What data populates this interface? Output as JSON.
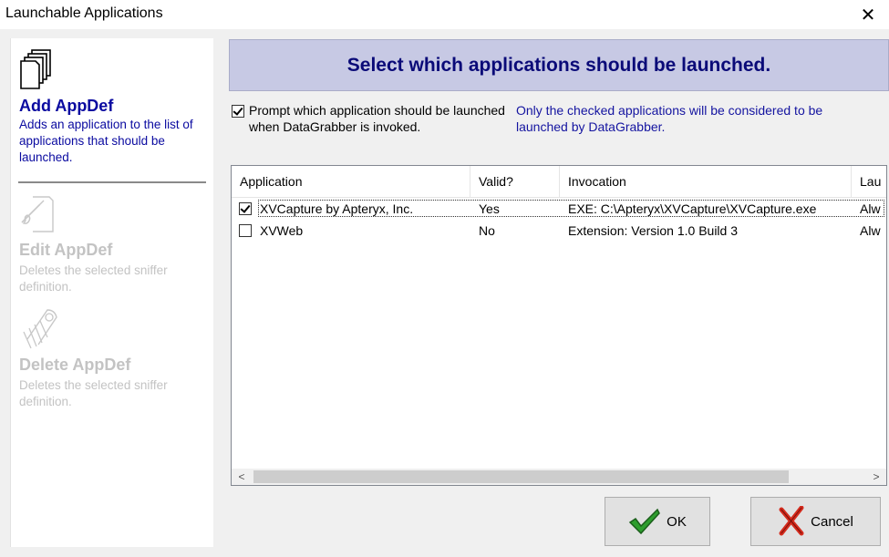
{
  "window": {
    "title": "Launchable Applications",
    "close_glyph": "✕"
  },
  "sidebar": {
    "add": {
      "title": "Add AppDef",
      "desc": "Adds an application to the list of applications that should be launched.",
      "icon": "document-stack-icon"
    },
    "edit": {
      "title": "Edit AppDef",
      "desc": "Deletes the selected sniffer definition.",
      "icon": "edit-document-icon"
    },
    "delete": {
      "title": "Delete AppDef",
      "desc": "Deletes the selected sniffer definition.",
      "icon": "shredder-icon"
    }
  },
  "banner": {
    "text": "Select which applications should be launched."
  },
  "prompt": {
    "checked": true,
    "text": "Prompt which application should be launched when DataGrabber is invoked."
  },
  "note": {
    "text": "Only the checked applications will be considered to be launched by DataGrabber."
  },
  "list": {
    "columns": [
      "Application",
      "Valid?",
      "Invocation",
      "Lau"
    ],
    "rows": [
      {
        "checked": true,
        "application": "XVCapture by Apteryx, Inc.",
        "valid": "Yes",
        "invocation": "EXE: C:\\Apteryx\\XVCapture\\XVCapture.exe",
        "launch": "Alw"
      },
      {
        "checked": false,
        "application": "XVWeb",
        "valid": "No",
        "invocation": "Extension: Version 1.0 Build 3",
        "launch": "Alw"
      }
    ],
    "scroll_left": "<",
    "scroll_right": ">"
  },
  "buttons": {
    "ok": "OK",
    "cancel": "Cancel"
  },
  "colors": {
    "banner_bg": "#c7c9e4",
    "banner_text": "#0a0a78",
    "link_blue": "#1414a0"
  }
}
